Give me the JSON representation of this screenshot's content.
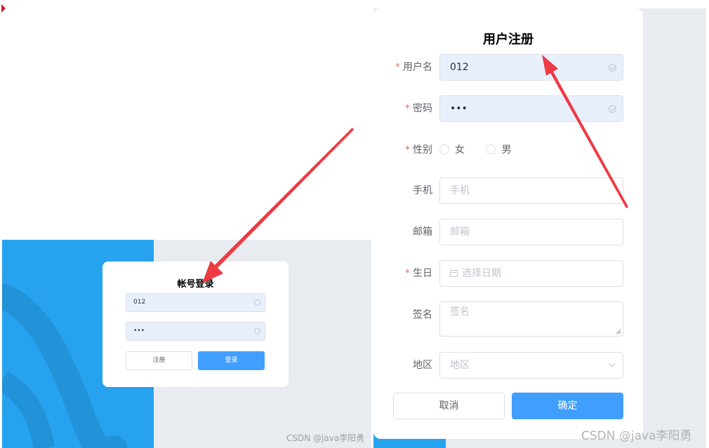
{
  "login": {
    "title": "帐号登录",
    "username_value": "012",
    "password_value": "•••",
    "register_label": "注册",
    "login_label": "登录",
    "watermark": "CSDN @java李阳勇"
  },
  "register": {
    "title": "用户注册",
    "fields": {
      "username": {
        "label": "用户名",
        "value": "012"
      },
      "password": {
        "label": "密码",
        "value": "•••"
      },
      "gender": {
        "label": "性别",
        "options": [
          "女",
          "男"
        ]
      },
      "phone": {
        "label": "手机",
        "placeholder": "手机"
      },
      "email": {
        "label": "邮箱",
        "placeholder": "邮箱"
      },
      "birthday": {
        "label": "生日",
        "placeholder": "选择日期"
      },
      "signature": {
        "label": "签名",
        "placeholder": "签名"
      },
      "region": {
        "label": "地区",
        "placeholder": "地区"
      }
    },
    "required_mark": "*",
    "cancel_label": "取消",
    "confirm_label": "确定",
    "watermark": "CSDN @java李阳勇"
  },
  "colors": {
    "primary": "#409eff",
    "sidebar_blue": "#27a2ee",
    "annotation_arrow": "#ee3a43",
    "autofill_bg": "#e8f0fe"
  }
}
